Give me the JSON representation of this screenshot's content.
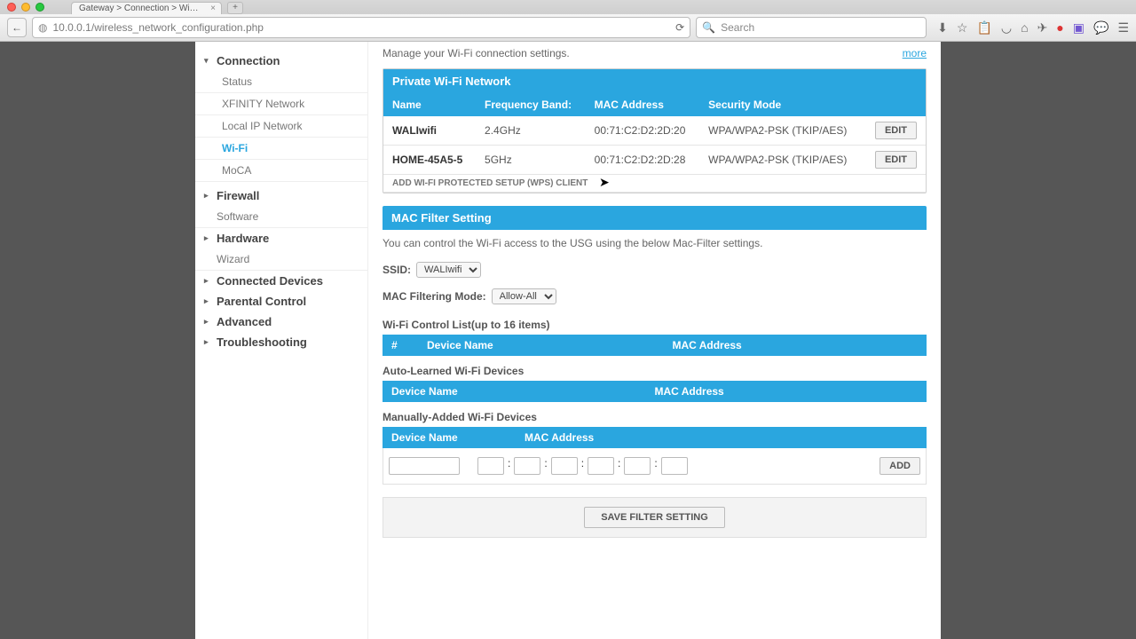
{
  "browser": {
    "tab_title": "Gateway > Connection > Wi-F…",
    "url": "10.0.0.1/wireless_network_configuration.php",
    "search_placeholder": "Search"
  },
  "intro_text": "Manage your Wi-Fi connection settings.",
  "more_label": "more",
  "sidebar": {
    "group0": {
      "label": "Connection",
      "expanded": true
    },
    "items": [
      {
        "label": "Status"
      },
      {
        "label": "XFINITY Network"
      },
      {
        "label": "Local IP Network"
      },
      {
        "label": "Wi-Fi",
        "active": true
      },
      {
        "label": "MoCA"
      }
    ],
    "groups": [
      {
        "label": "Firewall"
      },
      {
        "label": "Software",
        "no_caret": true
      },
      {
        "label": "Hardware"
      },
      {
        "label": "Wizard",
        "no_caret": true
      },
      {
        "label": "Connected Devices"
      },
      {
        "label": "Parental Control"
      },
      {
        "label": "Advanced"
      },
      {
        "label": "Troubleshooting"
      }
    ]
  },
  "private_panel": {
    "title": "Private Wi-Fi Network",
    "headers": {
      "name": "Name",
      "band": "Frequency Band:",
      "mac": "MAC Address",
      "sec": "Security Mode"
    },
    "rows": [
      {
        "name": "WALIwifi",
        "band": "2.4GHz",
        "mac": "00:71:C2:D2:2D:20",
        "sec": "WPA/WPA2-PSK (TKIP/AES)"
      },
      {
        "name": "HOME-45A5-5",
        "band": "5GHz",
        "mac": "00:71:C2:D2:2D:28",
        "sec": "WPA/WPA2-PSK (TKIP/AES)"
      }
    ],
    "edit_label": "EDIT",
    "wps_label": "ADD WI-FI PROTECTED SETUP (WPS) CLIENT"
  },
  "mac_filter": {
    "title": "MAC Filter Setting",
    "desc": "You can control the Wi-Fi access to the USG using the below Mac-Filter settings.",
    "ssid_label": "SSID:",
    "ssid_value": "WALIwifi",
    "mode_label": "MAC Filtering Mode:",
    "mode_value": "Allow-All",
    "control_list_title": "Wi-Fi Control List(up to 16 items)",
    "control_headers": {
      "num": "#",
      "name": "Device Name",
      "mac": "MAC Address"
    },
    "auto_title": "Auto-Learned Wi-Fi Devices",
    "auto_headers": {
      "name": "Device Name",
      "mac": "MAC Address"
    },
    "manual_title": "Manually-Added Wi-Fi Devices",
    "manual_headers": {
      "name": "Device Name",
      "mac": "MAC Address"
    },
    "add_label": "ADD",
    "save_label": "SAVE FILTER SETTING"
  }
}
